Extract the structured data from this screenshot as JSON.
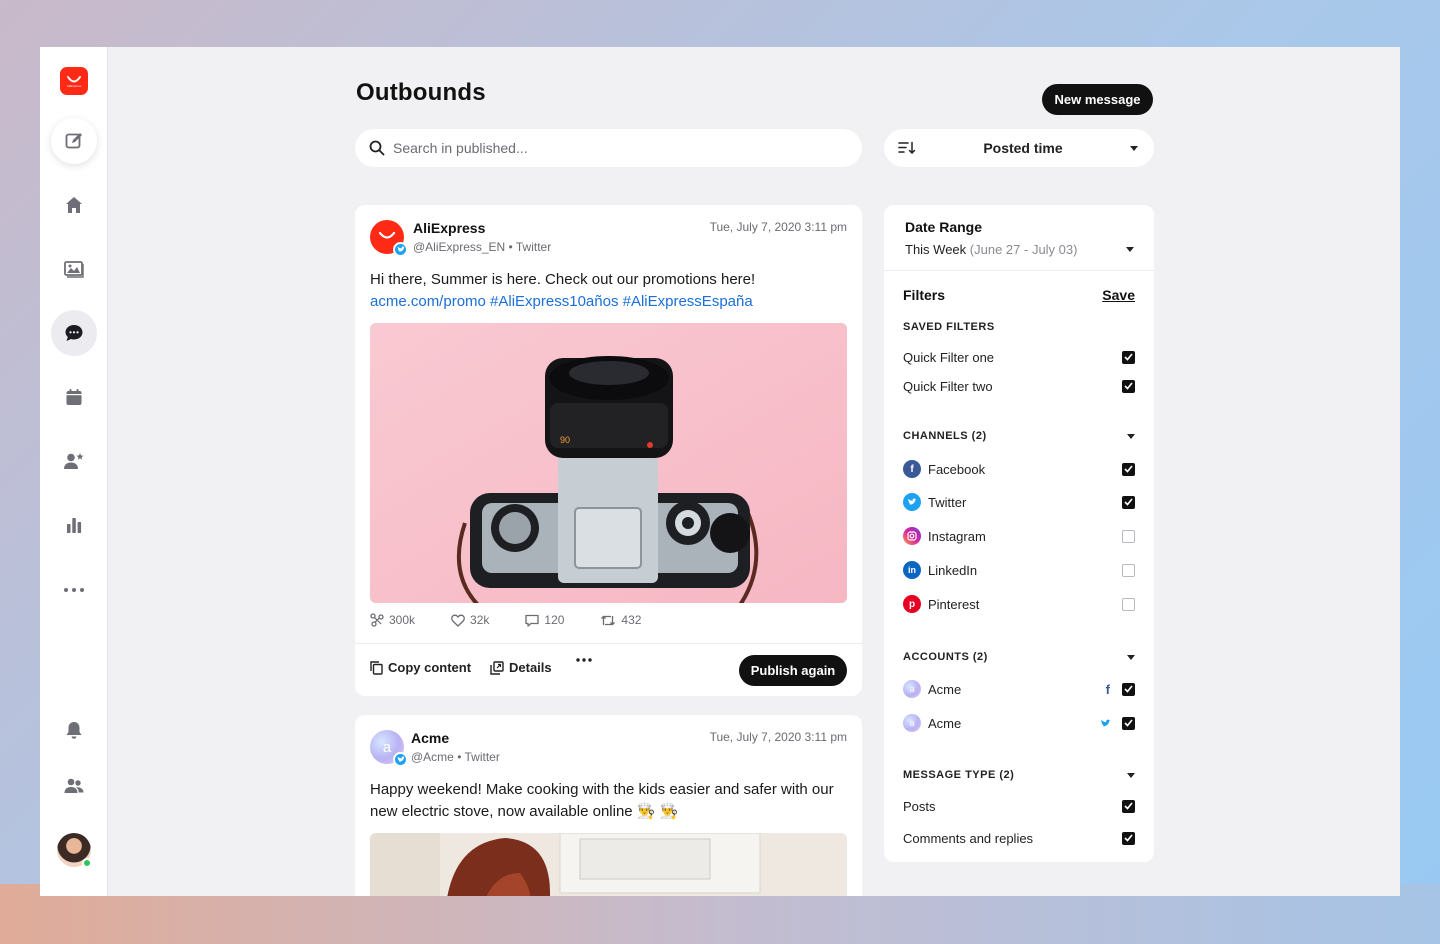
{
  "page": {
    "title": "Outbounds",
    "new_message_label": "New message"
  },
  "search": {
    "placeholder": "Search in published..."
  },
  "sort": {
    "label": "Posted time"
  },
  "sidebar": {
    "logo_text": "AliExpress",
    "items": [
      {
        "name": "compose",
        "icon": "edit-icon"
      },
      {
        "name": "home",
        "icon": "home-icon"
      },
      {
        "name": "media",
        "icon": "image-icon"
      },
      {
        "name": "messages",
        "icon": "chat-icon",
        "active": true
      },
      {
        "name": "calendar",
        "icon": "calendar-icon"
      },
      {
        "name": "contacts",
        "icon": "user-star-icon"
      },
      {
        "name": "analytics",
        "icon": "bar-chart-icon"
      },
      {
        "name": "more",
        "icon": "more-icon"
      },
      {
        "name": "notifications",
        "icon": "bell-icon"
      },
      {
        "name": "team",
        "icon": "team-icon"
      }
    ]
  },
  "posts": [
    {
      "author": "AliExpress",
      "handle": "@AliExpress_EN • Twitter",
      "date": "Tue, July 7, 2020 3:11 pm",
      "text": "Hi there, Summer is here. Check out our promotions here!",
      "link": "acme.com/promo #AliExpress10años #AliExpressEspaña",
      "stats": {
        "reach": "300k",
        "likes": "32k",
        "comments": "120",
        "retweets": "432"
      },
      "actions": {
        "copy": "Copy content",
        "details": "Details",
        "publish": "Publish again"
      }
    },
    {
      "author": "Acme",
      "avatar_letter": "a",
      "handle": "@Acme • Twitter",
      "date": "Tue, July 7, 2020 3:11 pm",
      "text": "Happy weekend! Make cooking with the kids easier and safer with our new electric stove, now available online 👨‍🍳 👨‍🍳"
    }
  ],
  "filters": {
    "date_range": {
      "title": "Date Range",
      "value": "This Week",
      "range": "(June 27 - July 03)"
    },
    "title": "Filters",
    "save_label": "Save",
    "saved_filters": {
      "title": "SAVED FILTERS",
      "items": [
        {
          "label": "Quick Filter one",
          "checked": true
        },
        {
          "label": "Quick Filter two",
          "checked": true
        }
      ]
    },
    "channels": {
      "title": "CHANNELS (2)",
      "items": [
        {
          "label": "Facebook",
          "checked": true,
          "color": "#3b5998"
        },
        {
          "label": "Twitter",
          "checked": true,
          "color": "#1da1f2"
        },
        {
          "label": "Instagram",
          "checked": false,
          "color": "#d6249f"
        },
        {
          "label": "LinkedIn",
          "checked": false,
          "color": "#0a66c2"
        },
        {
          "label": "Pinterest",
          "checked": false,
          "color": "#e60023"
        }
      ]
    },
    "accounts": {
      "title": "ACCOUNTS (2)",
      "items": [
        {
          "label": "Acme",
          "avatar_letter": "a",
          "network": "facebook",
          "checked": true
        },
        {
          "label": "Acme",
          "avatar_letter": "a",
          "network": "twitter",
          "checked": true
        }
      ]
    },
    "message_type": {
      "title": "MESSAGE TYPE (2)",
      "items": [
        {
          "label": "Posts",
          "checked": true
        },
        {
          "label": "Comments and replies",
          "checked": true
        }
      ]
    }
  }
}
